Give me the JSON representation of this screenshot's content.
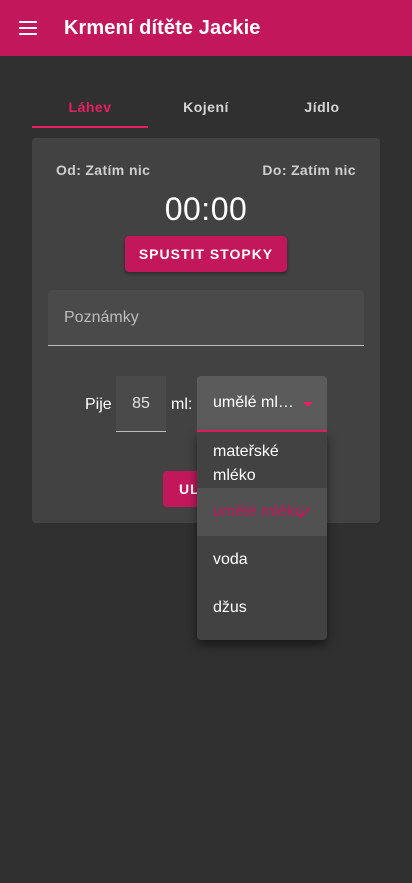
{
  "appbar": {
    "title": "Krmení dítěte Jackie"
  },
  "tabs": [
    {
      "label": "Láhev",
      "active": true
    },
    {
      "label": "Kojení",
      "active": false
    },
    {
      "label": "Jídlo",
      "active": false
    }
  ],
  "bottle": {
    "from_label": "Od:",
    "from_value": "Zatím nic",
    "to_label": "Do:",
    "to_value": "Zatím nic",
    "timer": "00:00",
    "start_button": "SPUSTIT STOPKY",
    "notes_placeholder": "Poznámky",
    "pije_label": "Pije",
    "amount": "85",
    "unit_label": "ml:",
    "save_button": "ULOŽIT",
    "select_value": "umělé ml…"
  },
  "dropdown": {
    "options": [
      {
        "label": "mateřské mléko",
        "selected": false
      },
      {
        "label": "umělé mléko",
        "selected": true
      },
      {
        "label": "voda",
        "selected": false
      },
      {
        "label": "džus",
        "selected": false
      }
    ]
  },
  "colors": {
    "primary": "#c2185b",
    "accent": "#e91e63",
    "background": "#303030",
    "card": "#424242"
  }
}
